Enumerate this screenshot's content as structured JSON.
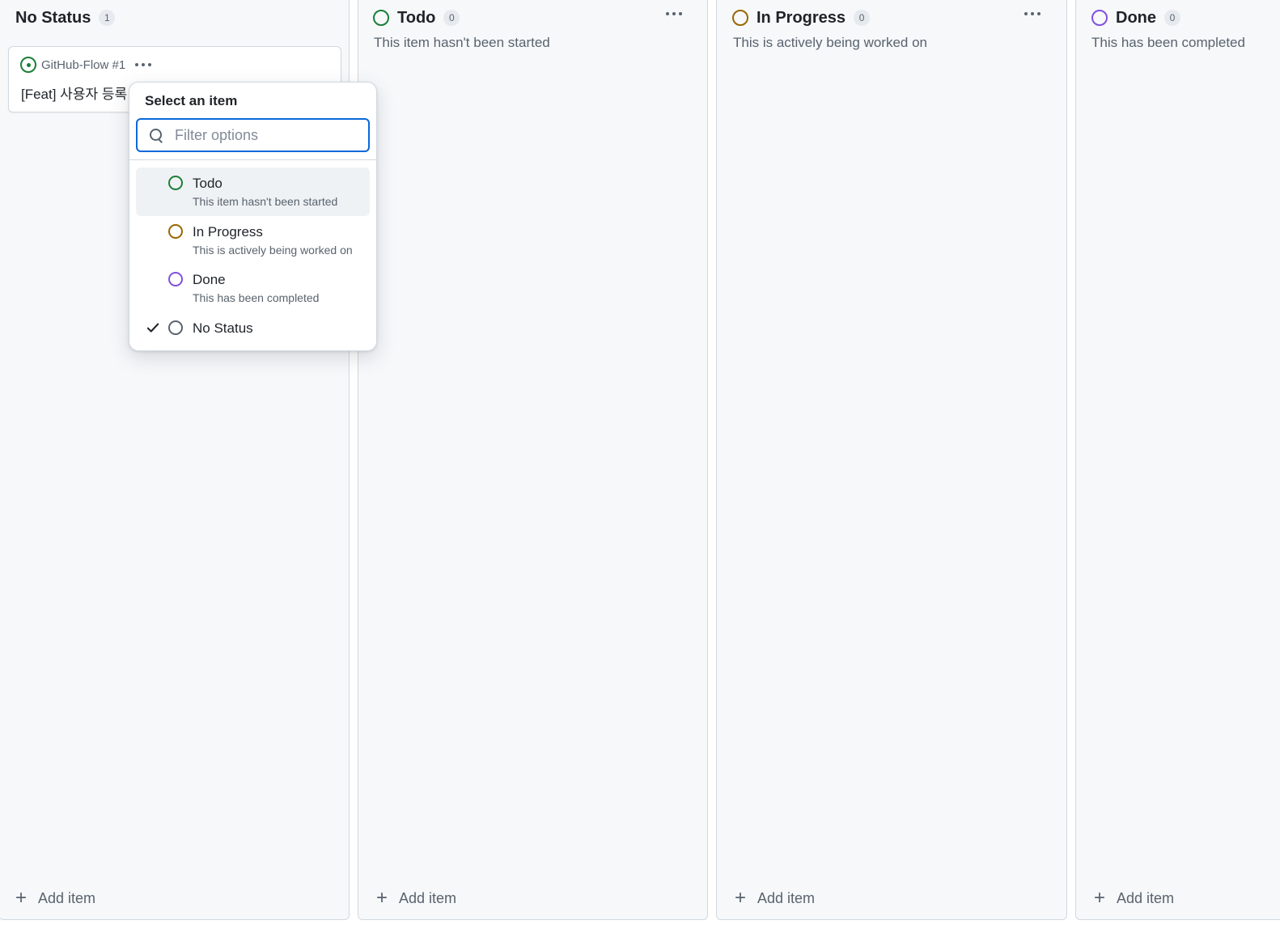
{
  "colors": {
    "todo": "#1a7f37",
    "in_progress": "#9a6700",
    "done": "#8250df",
    "no_status": "#59636e",
    "focus": "#0969da"
  },
  "columns": [
    {
      "title": "No Status",
      "count": "1",
      "description": "",
      "add_label": "Add item"
    },
    {
      "title": "Todo",
      "count": "0",
      "description": "This item hasn't been started",
      "add_label": "Add item"
    },
    {
      "title": "In Progress",
      "count": "0",
      "description": "This is actively being worked on",
      "add_label": "Add item"
    },
    {
      "title": "Done",
      "count": "0",
      "description": "This has been completed",
      "add_label": "Add item"
    }
  ],
  "card": {
    "repo_ref": "GitHub-Flow #1",
    "title": "[Feat] 사용자 등록"
  },
  "dropdown": {
    "title": "Select an item",
    "filter_placeholder": "Filter options",
    "filter_value": "",
    "options": [
      {
        "label": "Todo",
        "description": "This item hasn't been started",
        "selected": false
      },
      {
        "label": "In Progress",
        "description": "This is actively being worked on",
        "selected": false
      },
      {
        "label": "Done",
        "description": "This has been completed",
        "selected": false
      },
      {
        "label": "No Status",
        "description": "",
        "selected": true
      }
    ]
  },
  "icons": {
    "column_menu": "kebab-horizontal-icon",
    "add": "plus-icon",
    "issue": "issue-open-icon",
    "search": "search-icon",
    "check": "check-icon"
  }
}
